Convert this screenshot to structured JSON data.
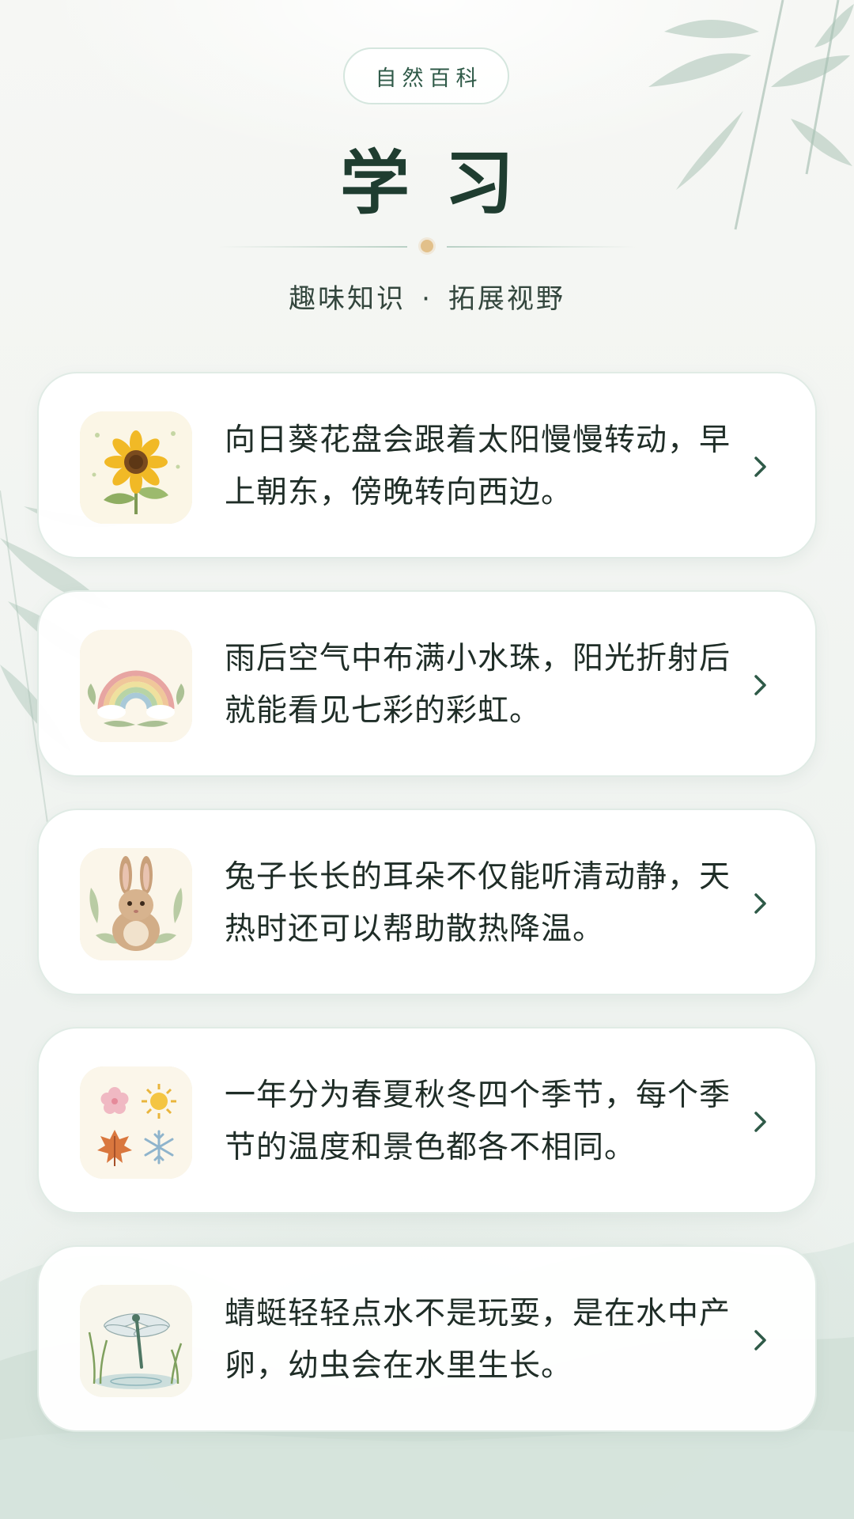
{
  "header": {
    "badge": "自然百科",
    "title": "学习",
    "subtitle_left": "趣味知识",
    "subtitle_sep": "·",
    "subtitle_right": "拓展视野"
  },
  "cards": [
    {
      "icon": "sunflower-icon",
      "text": "向日葵花盘会跟着太阳慢慢转动，早上朝东，傍晚转向西边。"
    },
    {
      "icon": "rainbow-icon",
      "text": "雨后空气中布满小水珠，阳光折射后就能看见七彩的彩虹。"
    },
    {
      "icon": "rabbit-icon",
      "text": "兔子长长的耳朵不仅能听清动静，天热时还可以帮助散热降温。"
    },
    {
      "icon": "seasons-icon",
      "text": "一年分为春夏秋冬四个季节，每个季节的温度和景色都各不相同。"
    },
    {
      "icon": "dragonfly-icon",
      "text": "蜻蜓轻轻点水不是玩耍，是在水中产卵，幼虫会在水里生长。"
    }
  ],
  "colors": {
    "title": "#1f3d30",
    "accent_dot": "#e2c08a",
    "card_border": "#e0ebe5",
    "chevron": "#2f5a48"
  }
}
